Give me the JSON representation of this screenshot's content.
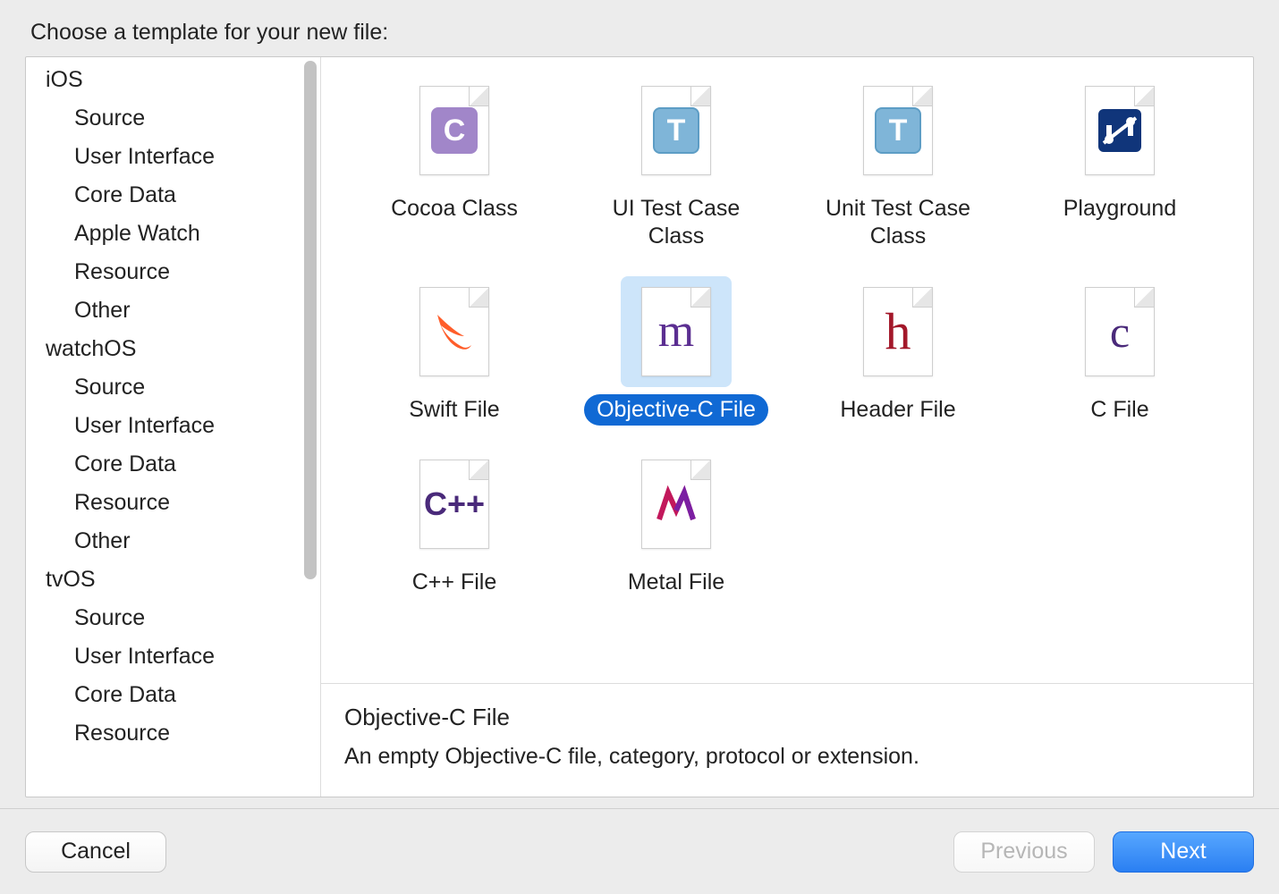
{
  "header": {
    "title": "Choose a template for your new file:"
  },
  "sidebar": {
    "platforms": [
      {
        "name": "iOS",
        "categories": [
          "Source",
          "User Interface",
          "Core Data",
          "Apple Watch",
          "Resource",
          "Other"
        ]
      },
      {
        "name": "watchOS",
        "categories": [
          "Source",
          "User Interface",
          "Core Data",
          "Resource",
          "Other"
        ]
      },
      {
        "name": "tvOS",
        "categories": [
          "Source",
          "User Interface",
          "Core Data",
          "Resource"
        ]
      }
    ]
  },
  "templates": [
    {
      "id": "cocoa-class",
      "label": "Cocoa Class",
      "icon": "badge-c-purple",
      "selected": false
    },
    {
      "id": "ui-test-case-class",
      "label": "UI Test Case Class",
      "icon": "badge-t-blue",
      "selected": false
    },
    {
      "id": "unit-test-case",
      "label": "Unit Test Case Class",
      "icon": "badge-t-blue",
      "selected": false
    },
    {
      "id": "playground",
      "label": "Playground",
      "icon": "playground",
      "selected": false
    },
    {
      "id": "swift-file",
      "label": "Swift File",
      "icon": "swift",
      "selected": false
    },
    {
      "id": "objc-file",
      "label": "Objective-C File",
      "icon": "letter-m",
      "selected": true
    },
    {
      "id": "header-file",
      "label": "Header File",
      "icon": "letter-h",
      "selected": false
    },
    {
      "id": "c-file",
      "label": "C File",
      "icon": "letter-c",
      "selected": false
    },
    {
      "id": "cpp-file",
      "label": "C++ File",
      "icon": "letter-cpp",
      "selected": false
    },
    {
      "id": "metal-file",
      "label": "Metal File",
      "icon": "metal",
      "selected": false
    }
  ],
  "description": {
    "title": "Objective-C File",
    "text": "An empty Objective-C file, category, protocol or extension."
  },
  "footer": {
    "cancel_label": "Cancel",
    "previous_label": "Previous",
    "next_label": "Next",
    "previous_enabled": false
  }
}
